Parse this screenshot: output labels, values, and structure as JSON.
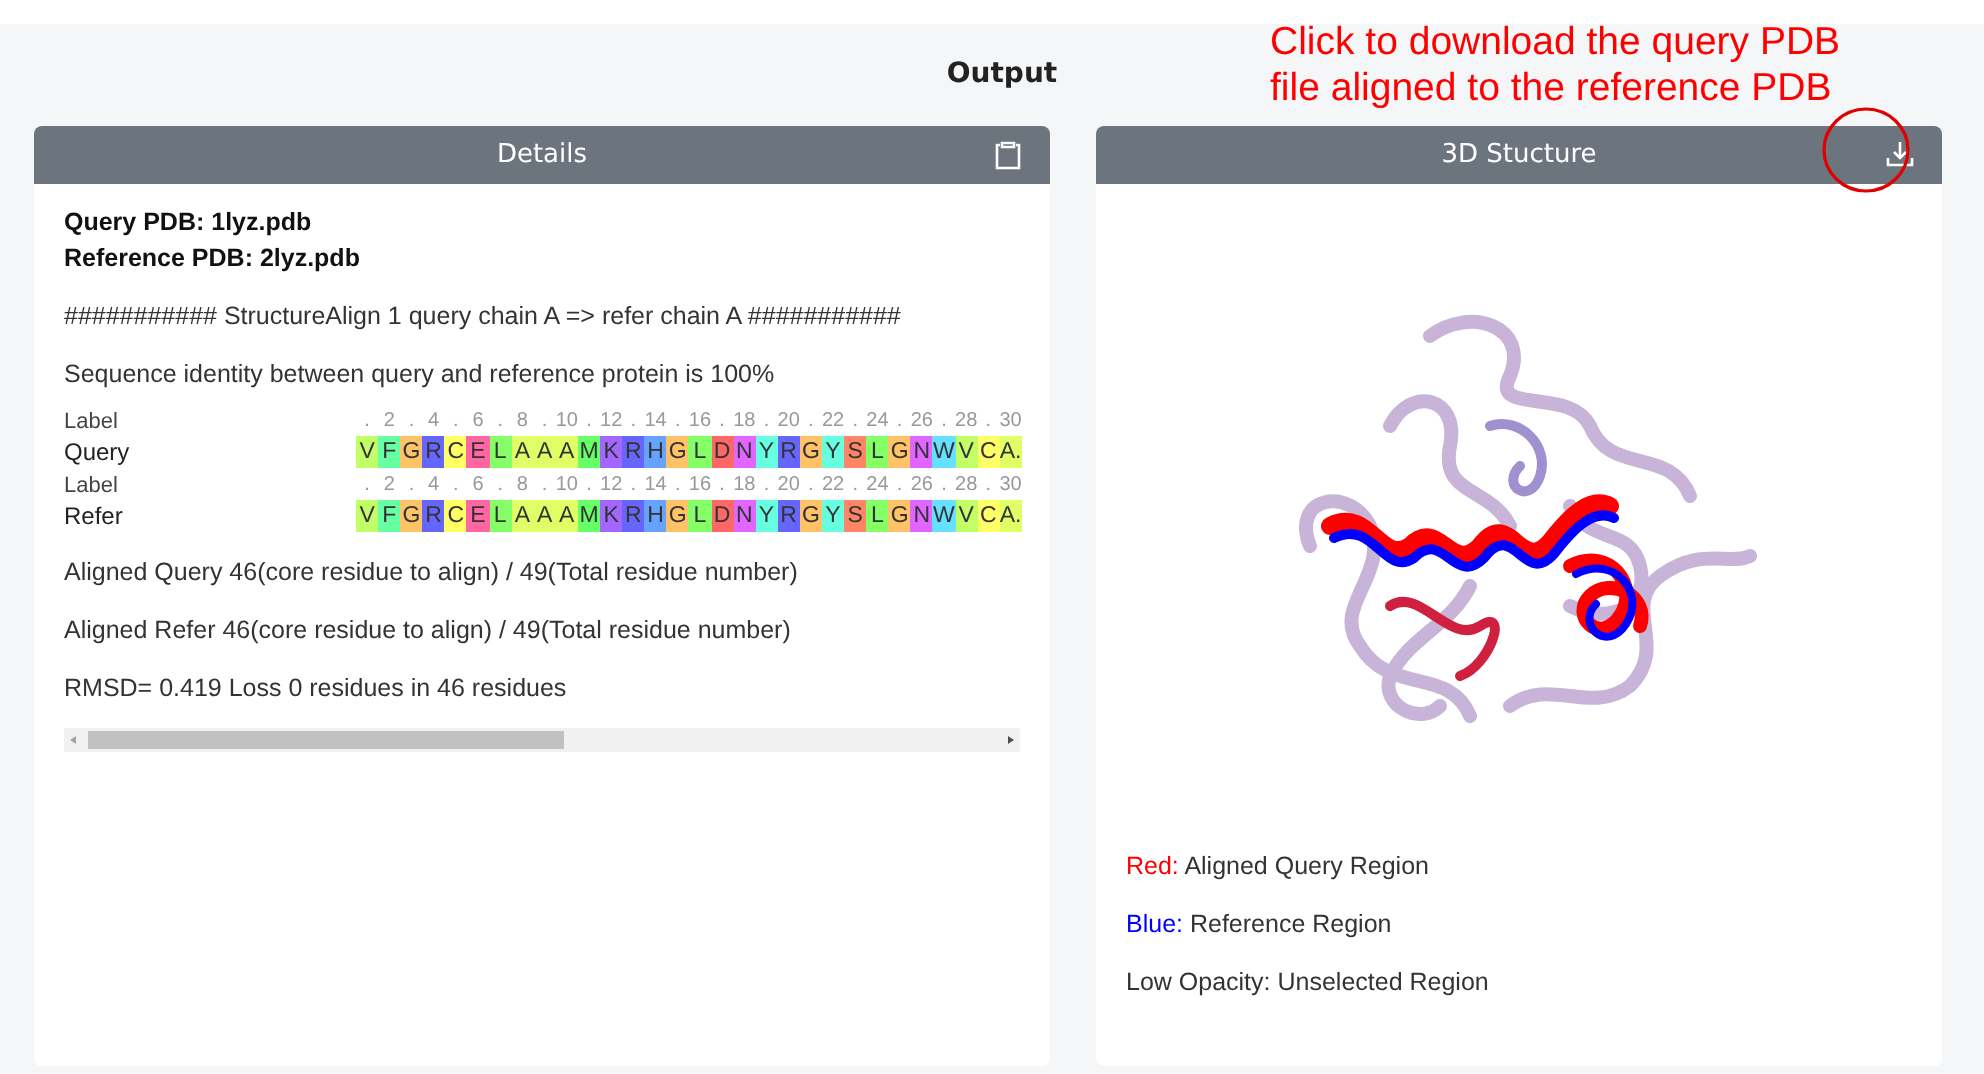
{
  "heading": "Output",
  "annotation": {
    "lines": [
      "Click to download the query PDB",
      "file aligned to the reference PDB"
    ]
  },
  "details": {
    "title": "Details",
    "pdb_lines": [
      "Query PDB: 1lyz.pdb",
      "Reference PDB: 2lyz.pdb"
    ],
    "messages": [
      "########### StructureAlign 1 query chain A => refer chain A ###########",
      "Sequence identity between query and reference protein is 100%"
    ],
    "alignment": [
      {
        "label": "Label",
        "name": "Query",
        "ruler": [
          ".",
          "2",
          ".",
          "4",
          ".",
          "6",
          ".",
          "8",
          ".",
          "10",
          ".",
          "12",
          ".",
          "14",
          ".",
          "16",
          ".",
          "18",
          ".",
          "20",
          ".",
          "22",
          ".",
          "24",
          ".",
          "26",
          ".",
          "28",
          ".",
          "30"
        ],
        "residues": [
          {
            "letter": "V",
            "color": "#c2ff66"
          },
          {
            "letter": "F",
            "color": "#66ffa3"
          },
          {
            "letter": "G",
            "color": "#ffc266"
          },
          {
            "letter": "R",
            "color": "#6666ff"
          },
          {
            "letter": "C",
            "color": "#ffff66"
          },
          {
            "letter": "E",
            "color": "#ff66a3"
          },
          {
            "letter": "L",
            "color": "#85ff66"
          },
          {
            "letter": "A",
            "color": "#e0ff66"
          },
          {
            "letter": "A",
            "color": "#e0ff66"
          },
          {
            "letter": "A",
            "color": "#e0ff66"
          },
          {
            "letter": "M",
            "color": "#66ff66"
          },
          {
            "letter": "K",
            "color": "#a366ff"
          },
          {
            "letter": "R",
            "color": "#6666ff"
          },
          {
            "letter": "H",
            "color": "#66a3ff"
          },
          {
            "letter": "G",
            "color": "#ffc266"
          },
          {
            "letter": "L",
            "color": "#85ff66"
          },
          {
            "letter": "D",
            "color": "#ff6666"
          },
          {
            "letter": "N",
            "color": "#e066ff"
          },
          {
            "letter": "Y",
            "color": "#66ffe0"
          },
          {
            "letter": "R",
            "color": "#6666ff"
          },
          {
            "letter": "G",
            "color": "#ffc266"
          },
          {
            "letter": "Y",
            "color": "#66ffe0"
          },
          {
            "letter": "S",
            "color": "#ff8566"
          },
          {
            "letter": "L",
            "color": "#85ff66"
          },
          {
            "letter": "G",
            "color": "#ffc266"
          },
          {
            "letter": "N",
            "color": "#e066ff"
          },
          {
            "letter": "W",
            "color": "#66e0ff"
          },
          {
            "letter": "V",
            "color": "#c2ff66"
          },
          {
            "letter": "C",
            "color": "#ffff66"
          },
          {
            "letter": "A.",
            "color": "#e0ff66"
          }
        ]
      },
      {
        "label": "Label",
        "name": "Refer",
        "ruler": [
          ".",
          "2",
          ".",
          "4",
          ".",
          "6",
          ".",
          "8",
          ".",
          "10",
          ".",
          "12",
          ".",
          "14",
          ".",
          "16",
          ".",
          "18",
          ".",
          "20",
          ".",
          "22",
          ".",
          "24",
          ".",
          "26",
          ".",
          "28",
          ".",
          "30"
        ],
        "residues": [
          {
            "letter": "V",
            "color": "#c2ff66"
          },
          {
            "letter": "F",
            "color": "#66ffa3"
          },
          {
            "letter": "G",
            "color": "#ffc266"
          },
          {
            "letter": "R",
            "color": "#6666ff"
          },
          {
            "letter": "C",
            "color": "#ffff66"
          },
          {
            "letter": "E",
            "color": "#ff66a3"
          },
          {
            "letter": "L",
            "color": "#85ff66"
          },
          {
            "letter": "A",
            "color": "#e0ff66"
          },
          {
            "letter": "A",
            "color": "#e0ff66"
          },
          {
            "letter": "A",
            "color": "#e0ff66"
          },
          {
            "letter": "M",
            "color": "#66ff66"
          },
          {
            "letter": "K",
            "color": "#a366ff"
          },
          {
            "letter": "R",
            "color": "#6666ff"
          },
          {
            "letter": "H",
            "color": "#66a3ff"
          },
          {
            "letter": "G",
            "color": "#ffc266"
          },
          {
            "letter": "L",
            "color": "#85ff66"
          },
          {
            "letter": "D",
            "color": "#ff6666"
          },
          {
            "letter": "N",
            "color": "#e066ff"
          },
          {
            "letter": "Y",
            "color": "#66ffe0"
          },
          {
            "letter": "R",
            "color": "#6666ff"
          },
          {
            "letter": "G",
            "color": "#ffc266"
          },
          {
            "letter": "Y",
            "color": "#66ffe0"
          },
          {
            "letter": "S",
            "color": "#ff8566"
          },
          {
            "letter": "L",
            "color": "#85ff66"
          },
          {
            "letter": "G",
            "color": "#ffc266"
          },
          {
            "letter": "N",
            "color": "#e066ff"
          },
          {
            "letter": "W",
            "color": "#66e0ff"
          },
          {
            "letter": "V",
            "color": "#c2ff66"
          },
          {
            "letter": "C",
            "color": "#ffff66"
          },
          {
            "letter": "A.",
            "color": "#e0ff66"
          }
        ]
      }
    ],
    "summary": [
      "Aligned Query 46(core residue to align) / 49(Total residue number)",
      "Aligned Refer 46(core residue to align) / 49(Total residue number)",
      "RMSD= 0.419 Loss 0 residues in 46 residues"
    ]
  },
  "structure": {
    "title": "3D Stucture",
    "legend": [
      {
        "key": "Red:",
        "color": "#ff0000",
        "text": "Aligned Query Region"
      },
      {
        "key": "Blue:",
        "color": "#0000ff",
        "text": "Reference Region"
      },
      {
        "key": "Low Opacity:",
        "color": "#333333",
        "text": "Unselected Region"
      }
    ]
  }
}
